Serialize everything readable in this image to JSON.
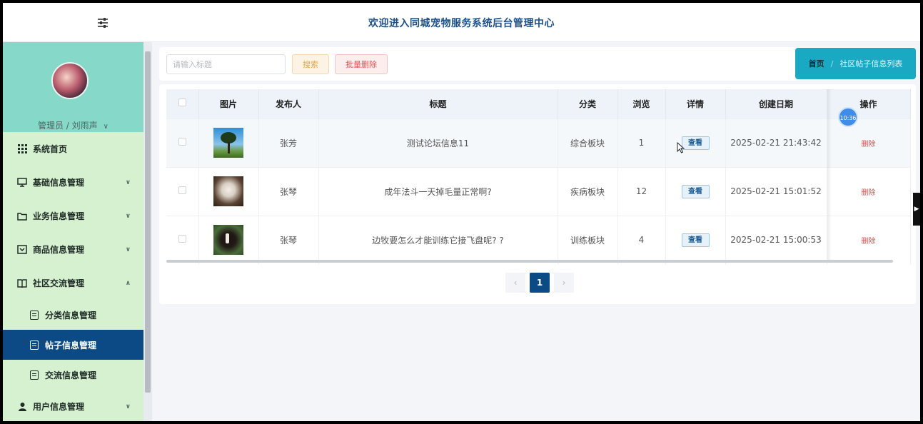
{
  "header": {
    "title": "欢迎进入同城宠物服务系统后台管理中心"
  },
  "sidebar": {
    "user": "管理员 / 刘雨声",
    "items": [
      {
        "label": "系统首页"
      },
      {
        "label": "基础信息管理"
      },
      {
        "label": "业务信息管理"
      },
      {
        "label": "商品信息管理"
      },
      {
        "label": "社区交流管理"
      },
      {
        "label": "分类信息管理"
      },
      {
        "label": "帖子信息管理"
      },
      {
        "label": "交流信息管理"
      },
      {
        "label": "用户信息管理"
      }
    ]
  },
  "toolbar": {
    "search_placeholder": "请输入标题",
    "search_label": "搜索",
    "bulk_delete_label": "批量删除"
  },
  "breadcrumb": {
    "home": "首页",
    "current": "社区帖子信息列表"
  },
  "table": {
    "columns": [
      "图片",
      "发布人",
      "标题",
      "分类",
      "浏览",
      "详情",
      "创建日期",
      "操作"
    ],
    "view_label": "查看",
    "delete_label": "删除",
    "rows": [
      {
        "publisher": "张芳",
        "title": "测试论坛信息11",
        "category": "综合板块",
        "views": "1",
        "created": "2025-02-21 21:43:42"
      },
      {
        "publisher": "张琴",
        "title": "成年法斗一天掉毛量正常啊?",
        "category": "疾病板块",
        "views": "12",
        "created": "2025-02-21 15:01:52"
      },
      {
        "publisher": "张琴",
        "title": "边牧要怎么才能训练它接飞盘呢? ?",
        "category": "训练板块",
        "views": "4",
        "created": "2025-02-21 15:00:53"
      }
    ]
  },
  "badge": {
    "time": "10:36"
  },
  "pagination": {
    "prev": "‹",
    "current": "1",
    "next": "›"
  }
}
